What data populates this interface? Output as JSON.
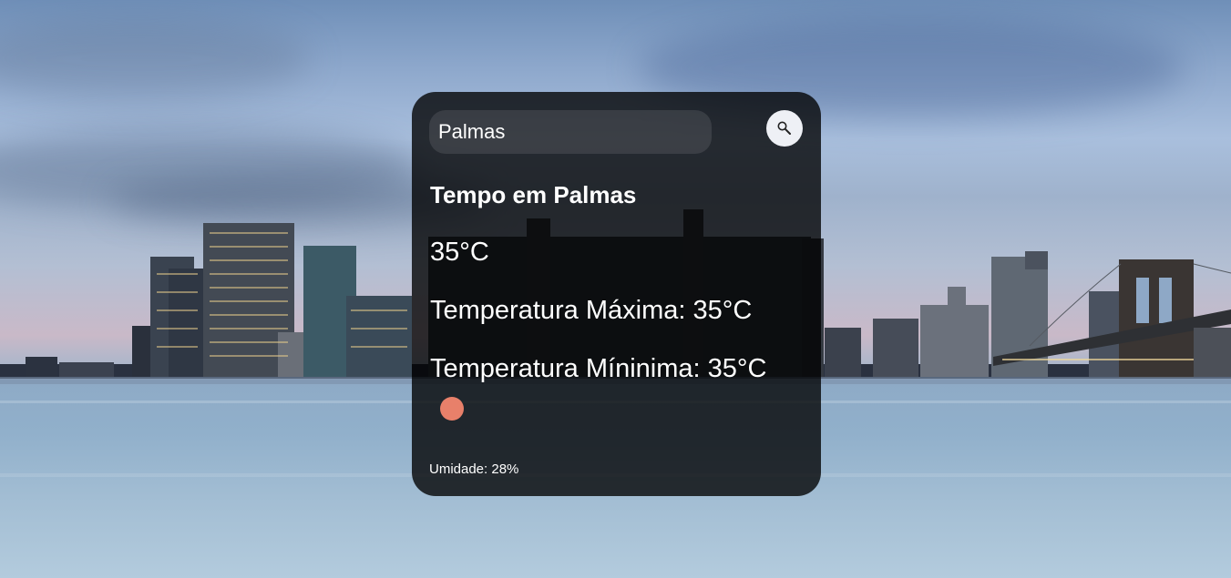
{
  "search": {
    "value": "Palmas",
    "placeholder": ""
  },
  "search_button": {
    "icon": "magnifier-icon"
  },
  "weather": {
    "title": "Tempo em Palmas",
    "temperature": "35°C",
    "max_temperature": "Temperatura Máxima: 35°C",
    "min_temperature": "Temperatura Míninima: 35°C",
    "humidity": "Umidade: 28%",
    "icon": "sun-icon"
  },
  "colors": {
    "card_bg": "#000000",
    "text": "#ffffff",
    "sun": "#e8806a",
    "search_button_bg": "#eef0f5"
  }
}
